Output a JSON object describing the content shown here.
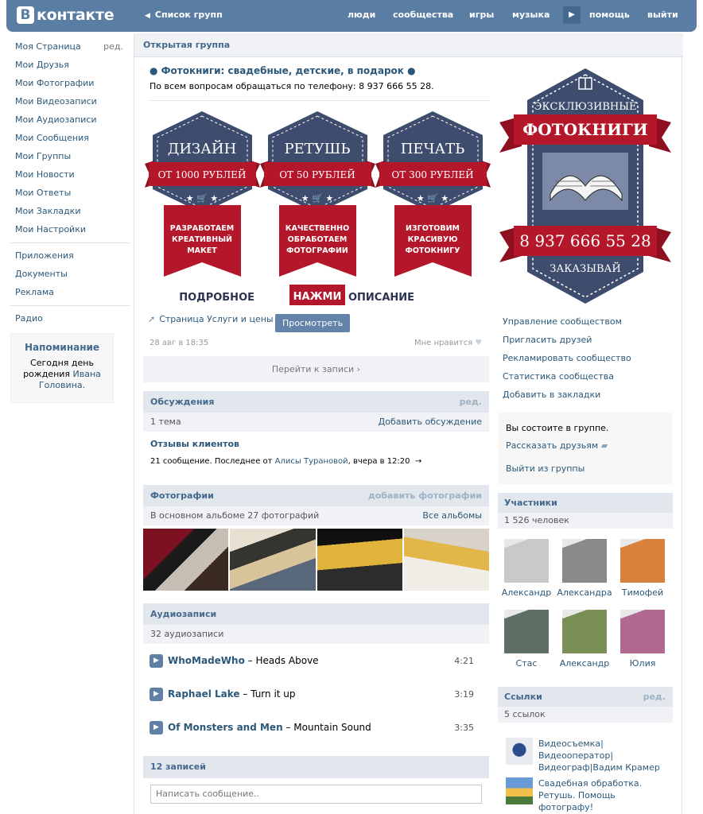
{
  "header": {
    "logo": "контакте",
    "logo_mark": "B",
    "back_label": "Список групп",
    "nav": [
      "люди",
      "сообщества",
      "игры",
      "музыка",
      "помощь",
      "выйти"
    ]
  },
  "left_menu": {
    "edit_label": "ред.",
    "items": [
      "Моя Страница",
      "Мои Друзья",
      "Мои Фотографии",
      "Мои Видеозаписи",
      "Мои Аудиозаписи",
      "Мои Сообщения",
      "Мои Группы",
      "Мои Новости",
      "Мои Ответы",
      "Мои Закладки",
      "Мои Настройки"
    ],
    "items2": [
      "Приложения",
      "Документы",
      "Реклама"
    ],
    "items3": [
      "Радио"
    ],
    "reminder": {
      "title": "Напоминание",
      "line1": "Сегодня день",
      "line2a": "рождения",
      "line2b": "Ивана",
      "line3": "Головина."
    }
  },
  "group": {
    "type": "Открытая группа",
    "title": "● Фотокниги: свадебные, детские, в подарок ●",
    "phone_line": "По всем вопросам обращаться по телефону: 8 937 666 55 28."
  },
  "banner": {
    "cards": [
      {
        "title": "ДИЗАЙН",
        "price": "ОТ 1000 РУБЛЕЙ",
        "l1": "РАЗРАБОТАЕМ",
        "l2": "КРЕАТИВНЫЙ",
        "l3": "МАКЕТ"
      },
      {
        "title": "РЕТУШЬ",
        "price": "ОТ 50 РУБЛЕЙ",
        "l1": "КАЧЕСТВЕННО",
        "l2": "ОБРАБОТАЕМ",
        "l3": "ФОТОГРАФИИ"
      },
      {
        "title": "ПЕЧАТЬ",
        "price": "ОТ 300 РУБЛЕЙ",
        "l1": "ИЗГОТОВИМ",
        "l2": "КРАСИВУЮ",
        "l3": "ФОТОКНИГУ"
      }
    ],
    "cta_left": "ПОДРОБНОЕ",
    "cta_button": "НАЖМИ",
    "cta_right": "ОПИСАНИЕ"
  },
  "post": {
    "attachment": "Страница Услуги и цены",
    "view_button": "Просмотреть",
    "date": "28 авг в 18:35",
    "like_label": "Мне нравится",
    "goto_post": "Перейти к записи"
  },
  "discussions": {
    "title": "Обсуждения",
    "edit": "ред.",
    "count": "1 тема",
    "add": "Добавить обсуждение",
    "topic": "Отзывы клиентов",
    "meta_prefix": "21 сообщение. Последнее от",
    "meta_author": "Алисы Турановой",
    "meta_time": ", вчера в 12:20"
  },
  "photos": {
    "title": "Фотографии",
    "add": "добавить фотографии",
    "count": "В основном альбоме 27 фотографий",
    "all": "Все альбомы"
  },
  "audio": {
    "title": "Аудиозаписи",
    "count": "32 аудиозаписи",
    "tracks": [
      {
        "artist": "WhoMadeWho",
        "song": "Heads Above",
        "duration": "4:21"
      },
      {
        "artist": "Raphael Lake",
        "song": "Turn it up",
        "duration": "3:19"
      },
      {
        "artist": "Of Monsters and Men",
        "song": "Mountain Sound",
        "duration": "3:35"
      }
    ]
  },
  "wall": {
    "title": "12 записей",
    "placeholder": "Написать сообщение.."
  },
  "poster": {
    "top": "ЭКСКЛЮЗИВНЫЕ",
    "ribbon": "ФОТОКНИГИ",
    "phone": "8 937 666 55 28",
    "bottom": "ЗАКАЗЫВАЙ"
  },
  "actions": [
    "Управление сообществом",
    "Пригласить друзей",
    "Рекламировать сообщество",
    "Статистика сообщества",
    "Добавить в закладки"
  ],
  "membership": {
    "status": "Вы состоите в группе.",
    "tell": "Рассказать друзьям",
    "leave": "Выйти из группы"
  },
  "members": {
    "title": "Участники",
    "count": "1 526 человек",
    "list": [
      {
        "name": "Александр",
        "color": "#c9c9c9"
      },
      {
        "name": "Александра",
        "color": "#8a8a8a"
      },
      {
        "name": "Тимофей",
        "color": "#d9823e"
      },
      {
        "name": "Стас",
        "color": "#5d6f62"
      },
      {
        "name": "Александр",
        "color": "#7a8f56"
      },
      {
        "name": "Юлия",
        "color": "#b06a8f"
      }
    ]
  },
  "links": {
    "title": "Ссылки",
    "edit": "ред.",
    "count": "5 ссылок",
    "items": [
      {
        "l1": "Видеосъемка|",
        "l2": "Видеооператор|",
        "l3": "Видеограф|Вадим Крамер"
      },
      {
        "l1": "Свадебная обработка.",
        "l2": "Ретушь. Помощь",
        "l3": "фотографу!"
      }
    ]
  },
  "colors": {
    "header": "#597da3",
    "link": "#2b587a",
    "banner_navy": "#3e4c6e",
    "banner_red": "#b5172a"
  }
}
